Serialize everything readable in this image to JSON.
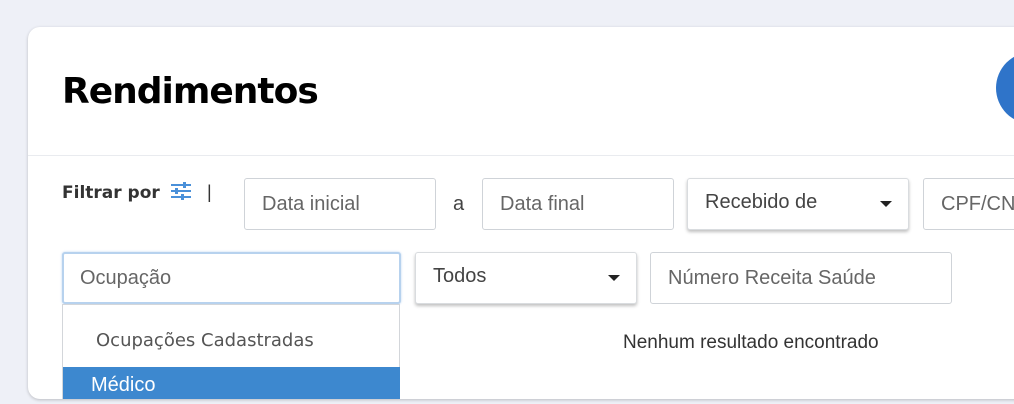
{
  "page": {
    "title": "Rendimentos"
  },
  "filters": {
    "label": "Filtrar por",
    "separator": "|",
    "date_start_placeholder": "Data inicial",
    "date_connector": "a",
    "date_end_placeholder": "Data final",
    "received_from": {
      "selected": "Recebido de"
    },
    "cpf_placeholder": "CPF/CN",
    "occupation_placeholder": "Ocupação",
    "status": {
      "selected": "Todos"
    },
    "receipt_number_placeholder": "Número Receita Saúde"
  },
  "occupation_dropdown": {
    "header": "Ocupações Cadastradas",
    "options": [
      {
        "label": "Médico",
        "highlighted": true
      }
    ]
  },
  "results": {
    "empty_message": "Nenhum resultado encontrado"
  },
  "icons": {
    "filter": "sliders-icon",
    "caret": "chevron-down-icon"
  },
  "colors": {
    "accent": "#2f74c9",
    "highlight": "#3d88cf",
    "background": "#eef0f7"
  }
}
